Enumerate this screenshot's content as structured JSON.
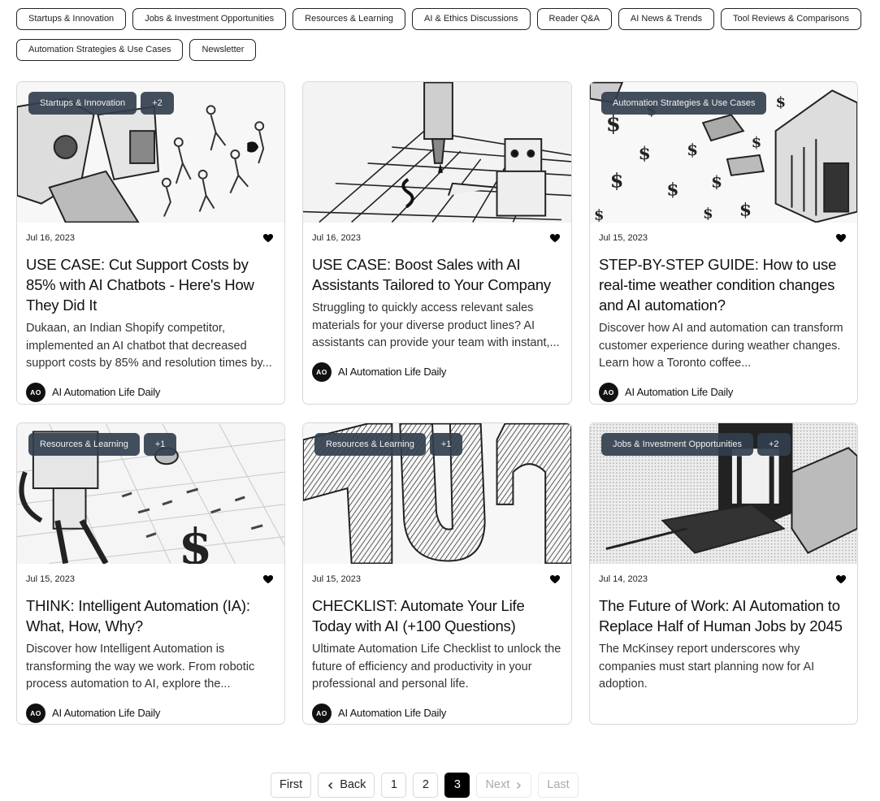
{
  "filters": [
    "Startups & Innovation",
    "Jobs & Investment Opportunities",
    "Resources & Learning",
    "AI & Ethics Discussions",
    "Reader Q&A",
    "AI News & Trends",
    "Tool Reviews & Comparisons",
    "Automation Strategies & Use Cases",
    "Newsletter"
  ],
  "author": {
    "name": "AI Automation Life Daily",
    "initials": "AO"
  },
  "posts": [
    {
      "tag": "Startups & Innovation",
      "more": "+2",
      "date": "Jul 16, 2023",
      "title": "USE CASE: Cut Support Costs by 85% with AI Chatbots - Here's How They Did It",
      "excerpt": "Dukaan, an Indian Shopify competitor, implemented an AI chatbot that decreased support costs by 85% and resolution times by...",
      "image": "robot-and-people-sketch"
    },
    {
      "tag": "",
      "more": "",
      "date": "Jul 16, 2023",
      "title": "USE CASE: Boost Sales with AI Assistants Tailored to Your Company",
      "excerpt": "Struggling to quickly access relevant sales materials for your diverse product lines? AI assistants can provide your team with instant,...",
      "image": "robot-arm-grid-sketch"
    },
    {
      "tag": "Automation Strategies & Use Cases",
      "more": "",
      "date": "Jul 15, 2023",
      "title": "STEP-BY-STEP GUIDE: How to use real-time weather condition changes and AI automation?",
      "excerpt": "Discover how AI and automation can transform customer experience during weather changes. Learn how a Toronto coffee...",
      "image": "dollar-signs-building-sketch"
    },
    {
      "tag": "Resources & Learning",
      "more": "+1",
      "date": "Jul 15, 2023",
      "title": "THINK: Intelligent Automation (IA): What, How, Why?",
      "excerpt": "Discover how Intelligent Automation is transforming the way we work. From robotic process automation to AI, explore the...",
      "image": "robot-dollar-sketch"
    },
    {
      "tag": "Resources & Learning",
      "more": "+1",
      "date": "Jul 15, 2023",
      "title": "CHECKLIST: Automate Your Life Today with AI (+100 Questions)",
      "excerpt": "Ultimate Automation Life Checklist to unlock the future of efficiency and productivity in your professional and personal life.",
      "image": "hatched-letters-sketch"
    },
    {
      "tag": "Jobs & Investment Opportunities",
      "more": "+2",
      "date": "Jul 14, 2023",
      "title": "The Future of Work: AI Automation to Replace Half of Human Jobs by 2045",
      "excerpt": "The McKinsey report underscores why companies must start planning now for AI adoption.",
      "image": "machine-box-sketch"
    }
  ],
  "pagination": {
    "first": "First",
    "back": "Back",
    "pages": [
      "1",
      "2",
      "3"
    ],
    "current": "3",
    "next": "Next",
    "last": "Last"
  }
}
